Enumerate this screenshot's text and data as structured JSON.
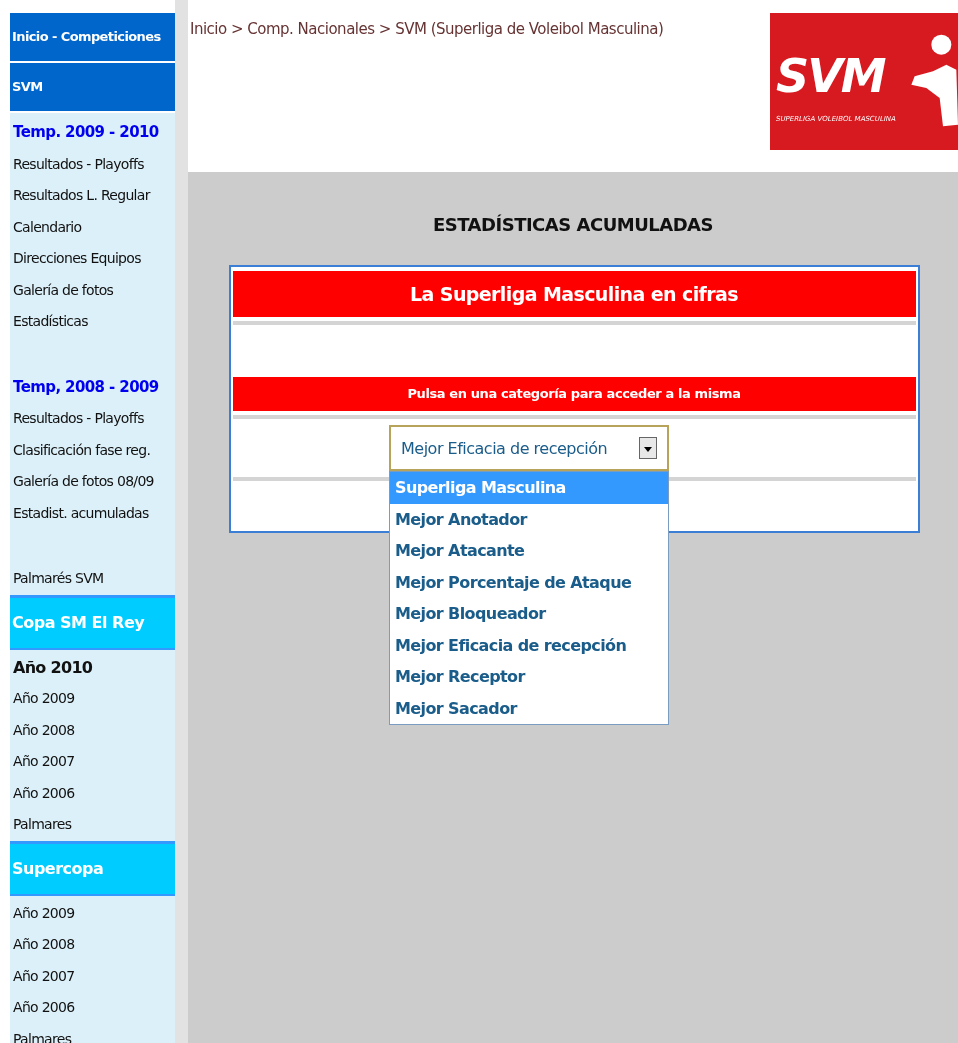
{
  "sidebar": [
    {
      "kind": "header",
      "label": "Inicio - Competiciones"
    },
    {
      "kind": "header",
      "label": "SVM"
    },
    {
      "kind": "block",
      "items": [
        {
          "kind": "season",
          "label": "Temp. 2009 - 2010"
        },
        {
          "kind": "link",
          "label": "Resultados - Playoffs",
          "selected": false
        },
        {
          "kind": "link",
          "label": "Resultados L. Regular",
          "selected": false
        },
        {
          "kind": "link",
          "label": "Calendario",
          "selected": false
        },
        {
          "kind": "link",
          "label": "Direcciones Equipos",
          "selected": false
        },
        {
          "kind": "link",
          "label": "Galería de fotos",
          "selected": false
        },
        {
          "kind": "link",
          "label": "Estadísticas",
          "selected": false
        }
      ]
    },
    {
      "kind": "block",
      "items": [
        {
          "kind": "season",
          "label": "Temp, 2008 - 2009"
        },
        {
          "kind": "link",
          "label": "Resultados - Playoffs",
          "selected": false
        },
        {
          "kind": "link",
          "label": "Clasificación fase reg.",
          "selected": false
        },
        {
          "kind": "link",
          "label": "Galería de fotos 08/09",
          "selected": false
        },
        {
          "kind": "link",
          "label": "Estadist. acumuladas",
          "selected": false
        }
      ]
    },
    {
      "kind": "block",
      "items": [
        {
          "kind": "link",
          "label": "Palmarés SVM",
          "selected": false
        }
      ]
    },
    {
      "kind": "section",
      "label": "Copa SM El Rey"
    },
    {
      "kind": "list",
      "items": [
        {
          "kind": "link",
          "label": "Año 2010",
          "selected": true
        },
        {
          "kind": "link",
          "label": "Año 2009",
          "selected": false
        },
        {
          "kind": "link",
          "label": "Año 2008",
          "selected": false
        },
        {
          "kind": "link",
          "label": "Año 2007",
          "selected": false
        },
        {
          "kind": "link",
          "label": "Año 2006",
          "selected": false
        },
        {
          "kind": "link",
          "label": "Palmares",
          "selected": false
        }
      ]
    },
    {
      "kind": "section",
      "label": "Supercopa"
    },
    {
      "kind": "list",
      "items": [
        {
          "kind": "link",
          "label": "Año 2009",
          "selected": false
        },
        {
          "kind": "link",
          "label": "Año 2008",
          "selected": false
        },
        {
          "kind": "link",
          "label": "Año 2007",
          "selected": false
        },
        {
          "kind": "link",
          "label": "Año 2006",
          "selected": false
        },
        {
          "kind": "link",
          "label": "Palmares",
          "selected": false
        }
      ]
    }
  ],
  "breadcrumb": "Inicio > Comp. Nacionales > SVM (Superliga de Voleibol Masculina)",
  "logo": {
    "title": "SVM",
    "subtitle": "SUPERLIGA VOLEIBOL MASCULINA"
  },
  "page_title": "ESTADÍSTICAS ACUMULADAS",
  "panel": {
    "title": "La Superliga Masculina en cifras",
    "instruction": "Pulsa en una categoría para acceder a la misma",
    "select": {
      "value": "Mejor Eficacia de recepción",
      "expanded": true,
      "options": [
        {
          "label": "Superliga Masculina",
          "highlighted": true
        },
        {
          "label": "Mejor Anotador",
          "highlighted": false
        },
        {
          "label": "Mejor Atacante",
          "highlighted": false
        },
        {
          "label": "Mejor Porcentaje de Ataque",
          "highlighted": false
        },
        {
          "label": "Mejor Bloqueador",
          "highlighted": false
        },
        {
          "label": "Mejor Eficacia de recepción",
          "highlighted": false
        },
        {
          "label": "Mejor Receptor",
          "highlighted": false
        },
        {
          "label": "Mejor Sacador",
          "highlighted": false
        }
      ]
    }
  }
}
